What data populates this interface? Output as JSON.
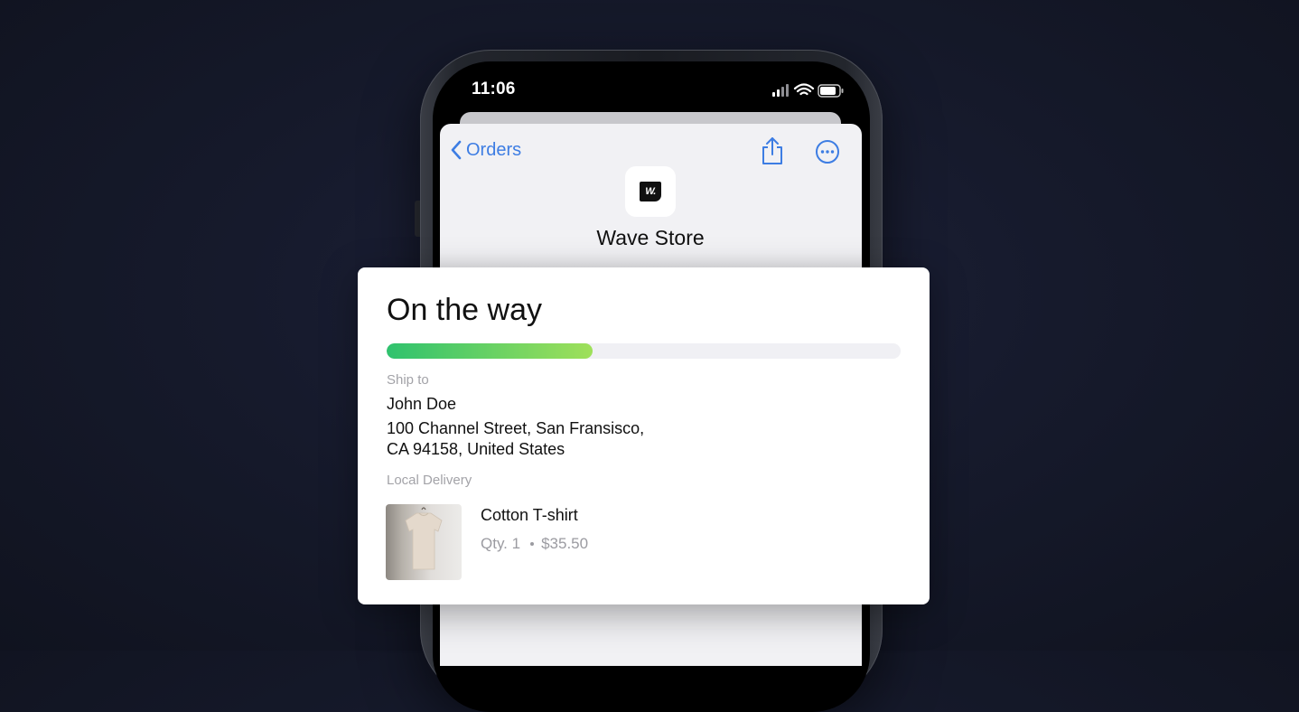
{
  "status_bar": {
    "time": "11:06"
  },
  "nav": {
    "back_label": "Orders"
  },
  "store": {
    "name": "Wave Store",
    "logo_text": "W."
  },
  "order": {
    "status_title": "On the way",
    "progress_fraction": 0.4,
    "ship_to_label": "Ship to",
    "recipient_name": "John Doe",
    "address_line1": "100 Channel Street, San Fransisco,",
    "address_line2": "CA 94158, United States",
    "delivery_method": "Local Delivery",
    "item": {
      "name": "Cotton T-shirt",
      "qty": "Qty. 1",
      "price": "$35.50"
    }
  },
  "colors": {
    "accent_blue": "#3d7de3",
    "progress_start": "#2fc26e",
    "progress_end": "#9fe05a"
  },
  "icons": {
    "back": "chevron-left-icon",
    "share": "share-icon",
    "more": "more-icon",
    "signal": "signal-icon",
    "wifi": "wifi-icon",
    "battery": "battery-icon"
  }
}
